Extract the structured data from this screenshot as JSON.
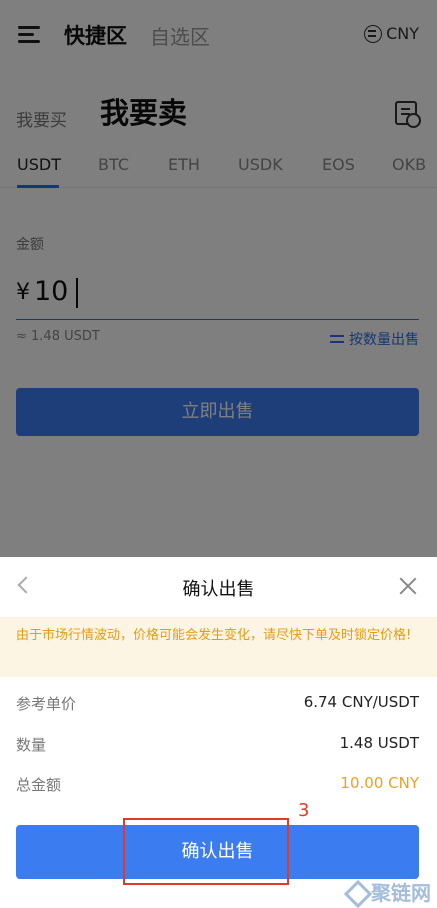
{
  "header": {
    "active_tab": "快捷区",
    "tab2": "自选区",
    "currency": "CNY"
  },
  "trade": {
    "buy_label": "我要买",
    "sell_label": "我要卖"
  },
  "coins": [
    "USDT",
    "BTC",
    "ETH",
    "USDK",
    "EOS",
    "OKB"
  ],
  "form": {
    "amount_label": "金额",
    "currency_symbol": "¥",
    "amount_value": "10",
    "approx_text": "≈ 1.48 USDT",
    "switch_label": "按数量出售",
    "sell_now": "立即出售"
  },
  "sheet": {
    "title": "确认出售",
    "warning": "由于市场行情波动，价格可能会发生变化，请尽快下单及时锁定价格!",
    "rows": [
      {
        "label": "参考单价",
        "value": "6.74 CNY/USDT"
      },
      {
        "label": "数量",
        "value": "1.48 USDT"
      },
      {
        "label": "总金额",
        "value": "10.00 CNY"
      }
    ],
    "confirm_label": "确认出售"
  },
  "annotation": {
    "step": "3"
  },
  "watermark": {
    "text": "聚链网"
  },
  "colors": {
    "accent": "#3b7cf0",
    "warning_text": "#e89a14",
    "total_value": "#f0a020",
    "annotation": "#e23a2a"
  }
}
